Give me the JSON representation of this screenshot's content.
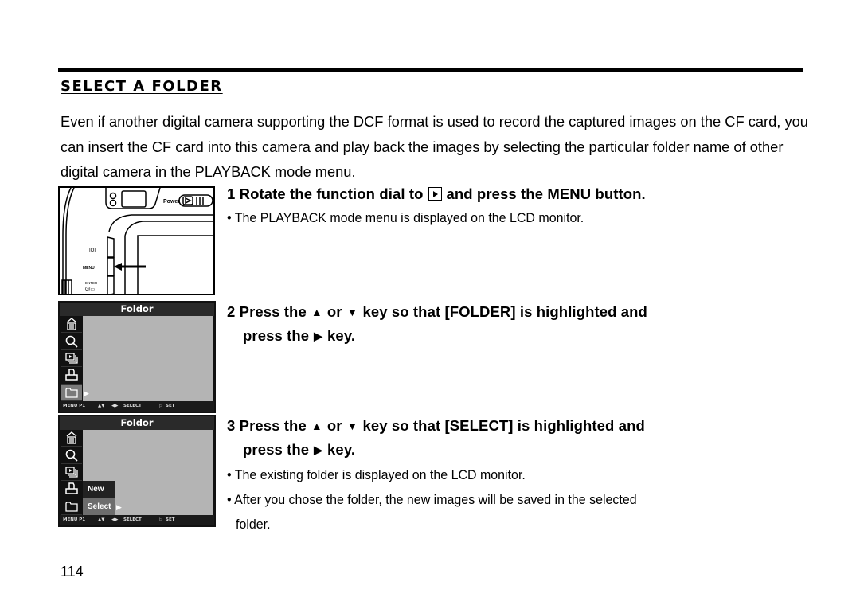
{
  "section": {
    "title": "SELECT A FOLDER",
    "intro": "Even if another digital camera supporting the DCF format is used to record the captured images on the CF card, you can insert the CF card into this camera and play back the images by selecting the particular folder name of other digital camera in the PLAYBACK mode menu."
  },
  "steps": [
    {
      "number": "1",
      "text_before_icon": "Rotate the function dial to",
      "icon": "playback-mode-icon",
      "text_after_icon": "and press the MENU button.",
      "bullets": [
        "The PLAYBACK mode menu is displayed on the LCD monitor."
      ]
    },
    {
      "number": "2",
      "part1": "Press the",
      "up_icon": "▲",
      "or": "or",
      "down_icon": "▼",
      "part2": "key so that [FOLDER] is highlighted and",
      "part3": "press the",
      "right_icon": "▶",
      "part4": "key."
    },
    {
      "number": "3",
      "part1": "Press the",
      "up_icon": "▲",
      "or": "or",
      "down_icon": "▼",
      "part2": "key so that [SELECT] is highlighted and",
      "part3": "press the",
      "right_icon": "▶",
      "part4": "key.",
      "bullets": [
        "The existing folder is displayed on the LCD monitor.",
        "After you chose the folder, the new images will be saved in the selected",
        "folder."
      ]
    }
  ],
  "camera_illustration": {
    "power_label": "Power",
    "button_labels": [
      "IOI",
      "MENU",
      "ENTER"
    ]
  },
  "lcd_screens": [
    {
      "title": "Foldor",
      "icons": [
        "delete-icon",
        "zoom-icon",
        "slideshow-icon",
        "print-icon",
        "folder-icon"
      ],
      "active_icon": "folder-icon",
      "footer": {
        "menu": "MENU P1",
        "nav": "▲▼",
        "select_arrows": "◀▶",
        "select": "SELECT",
        "set_arrow": "▷",
        "set": "SET"
      }
    },
    {
      "title": "Foldor",
      "icons": [
        "delete-icon",
        "zoom-icon",
        "slideshow-icon",
        "print-icon",
        "folder-icon"
      ],
      "active_icon": "folder-icon",
      "submenu": [
        "New",
        "Select"
      ],
      "submenu_selected": "Select",
      "footer": {
        "menu": "MENU P1",
        "nav": "▲▼",
        "select_arrows": "◀▶",
        "select": "SELECT",
        "set_arrow": "▷",
        "set": "SET"
      }
    }
  ],
  "page_number": "114",
  "bullet_char": "•"
}
